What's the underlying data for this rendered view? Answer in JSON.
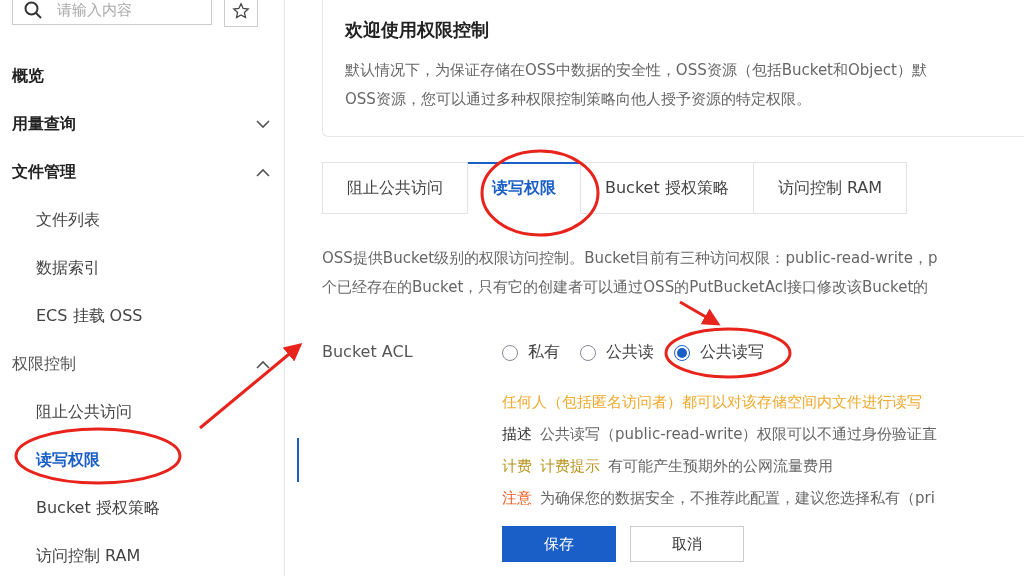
{
  "sidebar": {
    "search": {
      "placeholder": "请输入内容"
    },
    "items": [
      {
        "label": "概览",
        "kind": "group"
      },
      {
        "label": "用量查询",
        "kind": "group",
        "expanded": false
      },
      {
        "label": "文件管理",
        "kind": "group",
        "expanded": true,
        "children": [
          {
            "label": "文件列表",
            "selected": false
          },
          {
            "label": "数据索引",
            "selected": false
          },
          {
            "label": "ECS 挂载 OSS",
            "selected": false
          }
        ]
      },
      {
        "label": "权限控制",
        "kind": "section",
        "expanded": true,
        "children": [
          {
            "label": "阻止公共访问",
            "selected": false
          },
          {
            "label": "读写权限",
            "selected": true
          },
          {
            "label": "Bucket 授权策略",
            "selected": false
          },
          {
            "label": "访问控制 RAM",
            "selected": false
          }
        ]
      }
    ]
  },
  "intro": {
    "title": "欢迎使用权限控制",
    "lines": [
      "默认情况下，为保证存储在OSS中数据的安全性，OSS资源（包括Bucket和Object）默",
      "OSS资源，您可以通过多种权限控制策略向他人授予资源的特定权限。"
    ]
  },
  "tabs": [
    {
      "label": "阻止公共访问",
      "selected": false
    },
    {
      "label": "读写权限",
      "selected": true
    },
    {
      "label": "Bucket 授权策略",
      "selected": false
    },
    {
      "label": "访问控制 RAM",
      "selected": false
    }
  ],
  "description": [
    "OSS提供Bucket级别的权限访问控制。Bucket目前有三种访问权限：public-read-write，p",
    "个已经存在的Bucket，只有它的创建者可以通过OSS的PutBucketAcl接口修改该Bucket的"
  ],
  "acl": {
    "label": "Bucket ACL",
    "options": [
      {
        "label": "私有",
        "selected": false
      },
      {
        "label": "公共读",
        "selected": false
      },
      {
        "label": "公共读写",
        "selected": true
      }
    ],
    "warning": "任何人（包括匿名访问者）都可以对该存储空间内文件进行读写",
    "notes": [
      {
        "kind": "info",
        "tag": "描述",
        "text": "公共读写（public-read-write）权限可以不通过身份验证直"
      },
      {
        "kind": "fee",
        "tag": "计费",
        "link": "计费提示",
        "text": "有可能产生预期外的公网流量费用"
      },
      {
        "kind": "danger",
        "tag": "注意",
        "text": "为确保您的数据安全，不推荐此配置，建议您选择私有（pri"
      }
    ]
  },
  "buttons": [
    {
      "label": "保存",
      "kind": "primary"
    },
    {
      "label": "取消",
      "kind": "default"
    }
  ]
}
